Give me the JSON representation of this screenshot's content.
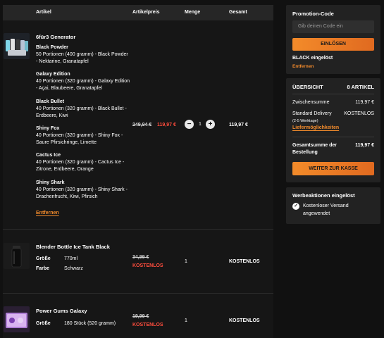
{
  "table": {
    "headers": {
      "article": "Artikel",
      "price": "Artikelpreis",
      "qty": "Menge",
      "total": "Gesamt"
    }
  },
  "items": [
    {
      "name": "6für3 Generator",
      "variants": [
        {
          "title": "Black Powder",
          "line1": "50 Portionen (400 gramm) - Black Powder",
          "line2": "- Nektarine, Granatapfel"
        },
        {
          "title": "Galaxy Edition",
          "line1": "40 Portionen (320 gramm) - Galaxy Edition",
          "line2": "- Açai, Blaubeere, Granatapfel"
        },
        {
          "title": "Black Bullet",
          "line1": "40 Portionen (320 gramm) - Black Bullet -",
          "line2": "Erdbeere, Kiwi"
        },
        {
          "title": "Shiny Fox",
          "line1": "40 Portionen (320 gramm) - Shiny Fox -",
          "line2": "Saure Pfirsichringe, Limette"
        },
        {
          "title": "Cactus Ice",
          "line1": "40 Portionen (320 gramm) - Cactus Ice -",
          "line2": "Zitrone, Erdbeere, Orange"
        },
        {
          "title": "Shiny Shark",
          "line1": "40 Portionen (320 gramm) - Shiny Shark -",
          "line2": "Drachenfrucht, Kiwi, Pfirsich"
        }
      ],
      "remove": "Entfernen",
      "old_price": "249,94 €",
      "price": "119,97 €",
      "qty": "1",
      "minus": "−",
      "plus": "+",
      "total": "119,97 €"
    },
    {
      "name": "Blender Bottle Ice Tank Black",
      "attrs": [
        {
          "label": "Größe",
          "value": "770ml"
        },
        {
          "label": "Farbe",
          "value": "Schwarz"
        }
      ],
      "old_price": "34,99 €",
      "price": "KOSTENLOS",
      "qty": "1",
      "total": "KOSTENLOS"
    },
    {
      "name": "Power Gums Galaxy",
      "attrs": [
        {
          "label": "Größe",
          "value": "180 Stück (520 gramm)"
        }
      ],
      "old_price": "19,99 €",
      "price": "KOSTENLOS",
      "qty": "1",
      "total": "KOSTENLOS"
    }
  ],
  "promo": {
    "title": "Promotion-Code",
    "placeholder": "Gib deinen Code ein",
    "button": "EINLÖSEN",
    "applied": "BLACK eingelöst",
    "remove": "Entfernen"
  },
  "summary": {
    "title": "ÜBERSICHT",
    "count": "8 ARTIKEL",
    "subtotal_label": "Zwischensumme",
    "subtotal": "119,97 €",
    "delivery_label": "Standard Delivery",
    "delivery_value": "KOSTENLOS",
    "delivery_days": "(2-5 Werktage)",
    "delivery_options": "Liefermöglichkeiten",
    "total_label_1": "Gesamtsumme der",
    "total_label_2": "Bestellung",
    "total": "119,97 €",
    "checkout": "WEITER ZUR KASSE"
  },
  "promotions": {
    "title": "Werbeaktionen eingelöst",
    "line1": "Kostenloser Versand",
    "line2": "angewendet"
  },
  "colors": {
    "accent": "#f08a2c",
    "sale": "#ff4d3d",
    "panel": "#222222",
    "background": "#111111"
  }
}
